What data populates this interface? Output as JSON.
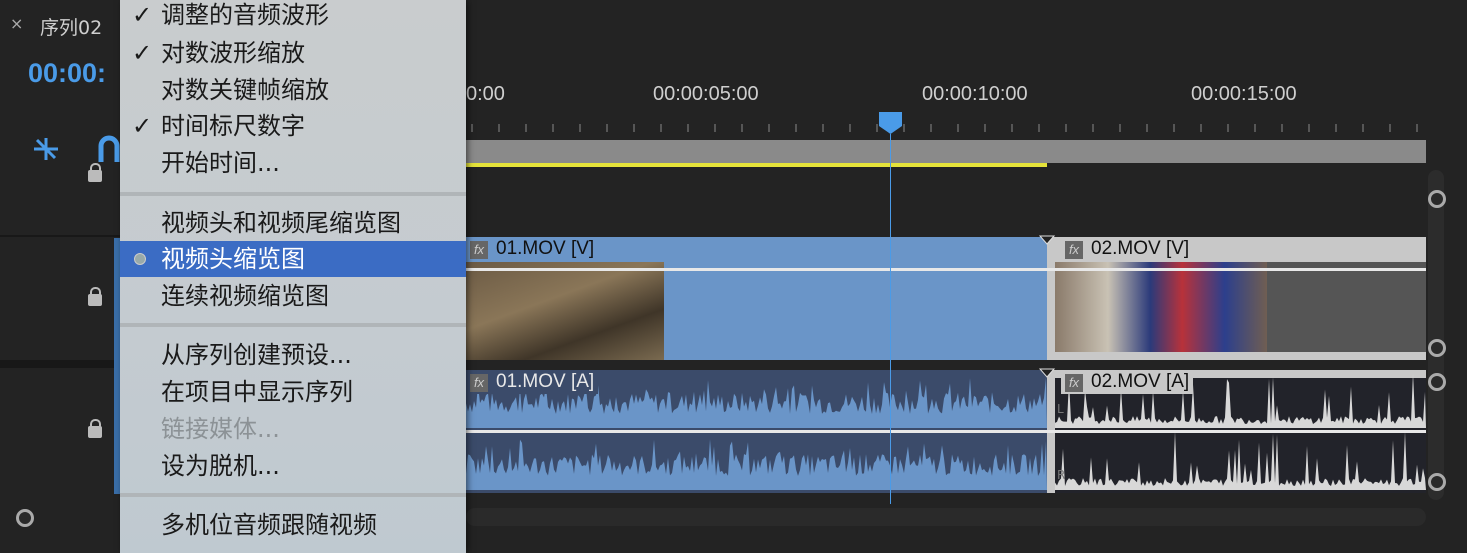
{
  "panel": {
    "close": "×",
    "title": "序列02",
    "timecode": "00:00:"
  },
  "menu": {
    "items": [
      {
        "label": "调整的音频波形",
        "checked": true
      },
      {
        "label": "对数波形缩放",
        "checked": true
      },
      {
        "label": "对数关键帧缩放",
        "checked": false
      },
      {
        "label": "时间标尺数字",
        "checked": true
      },
      {
        "label": "开始时间...",
        "checked": false
      },
      {
        "label": "视频头和视频尾缩览图",
        "checked": false
      },
      {
        "label": "视频头缩览图",
        "selected": true
      },
      {
        "label": "连续视频缩览图",
        "checked": false
      },
      {
        "label": "从序列创建预设...",
        "checked": false
      },
      {
        "label": "在项目中显示序列",
        "checked": false
      },
      {
        "label": "链接媒体...",
        "disabled": true
      },
      {
        "label": "设为脱机...",
        "checked": false
      },
      {
        "label": "多机位音频跟随视频",
        "checked": false
      }
    ],
    "check": "✓"
  },
  "ruler": {
    "labels": [
      "0:00",
      "00:00:05:00",
      "00:00:10:00",
      "00:00:15:00"
    ]
  },
  "clips": {
    "v1": "01.MOV [V]",
    "v2": "02.MOV [V]",
    "a1": "01.MOV [A]",
    "a2": "02.MOV [A]",
    "fx": "fx",
    "L": "L",
    "R": "R"
  },
  "colors": {
    "accent": "#4a9be8",
    "clip_blue": "#6a95c8",
    "work_area": "#e5e33a"
  }
}
